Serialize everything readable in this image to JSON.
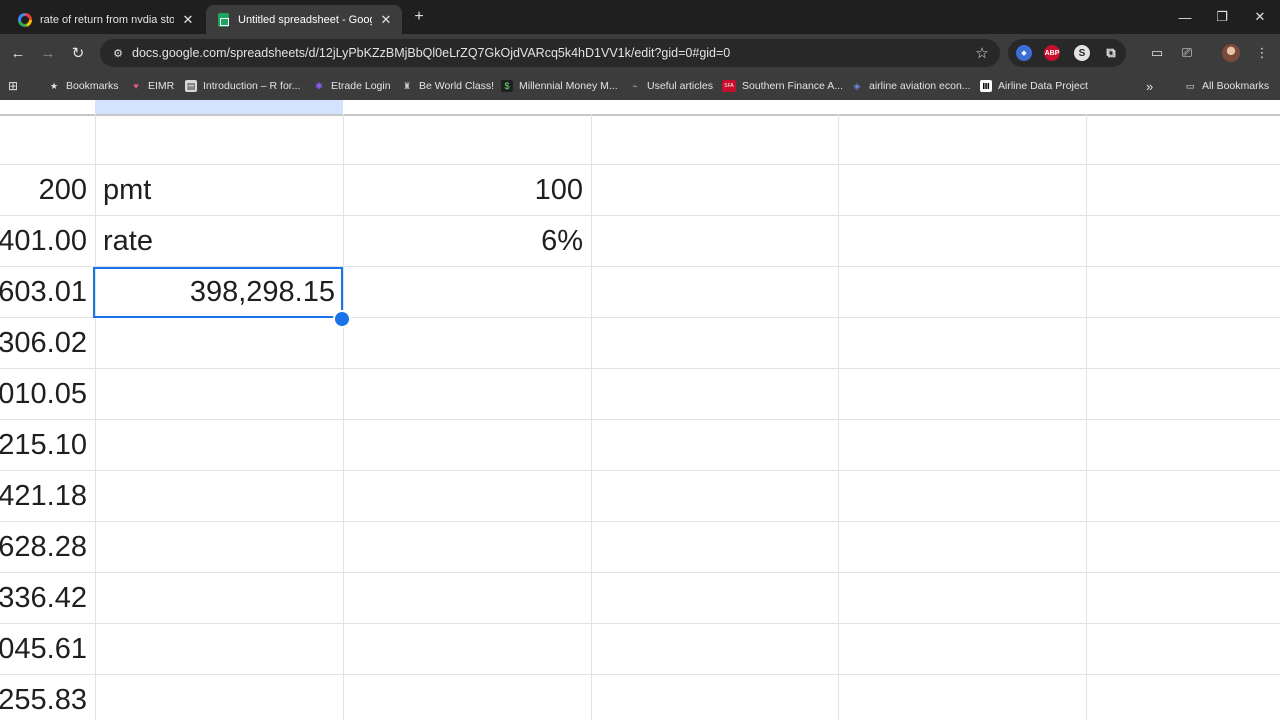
{
  "browser": {
    "tabs": [
      {
        "title": "rate of return from nvdia stock",
        "favicon": "google-icon",
        "active": false
      },
      {
        "title": "Untitled spreadsheet - Google S",
        "favicon": "sheets-icon",
        "active": true
      }
    ],
    "new_tab_label": "+",
    "window_controls": {
      "minimize": "—",
      "restore": "❐",
      "close": "✕"
    },
    "url": "docs.google.com/spreadsheets/d/12jLyPbKZzBMjBbQl0eLrZQ7GkOjdVARcq5k4hD1VV1k/edit?gid=0#gid=0",
    "bookmarks": [
      {
        "label": "Bookmarks",
        "icon": "star-icon"
      },
      {
        "label": "EIMR",
        "icon": "heart-icon"
      },
      {
        "label": "Introduction – R for...",
        "icon": "page-icon"
      },
      {
        "label": "Etrade Login",
        "icon": "etrade-icon"
      },
      {
        "label": "Be World Class!",
        "icon": "trophy-icon"
      },
      {
        "label": "Millennial Money M...",
        "icon": "dollar-icon"
      },
      {
        "label": "Useful articles",
        "icon": "link-icon"
      },
      {
        "label": "Southern Finance A...",
        "icon": "sfa-icon"
      },
      {
        "label": "airline aviation econ...",
        "icon": "plane-icon"
      },
      {
        "label": "Airline Data Project",
        "icon": "mit-icon"
      }
    ],
    "more_bookmarks": "»",
    "all_bookmarks": "All Bookmarks"
  },
  "sheet": {
    "columnA": [
      "200",
      "401.00",
      "603.01",
      "306.02",
      "010.05",
      "215.10",
      "421.18",
      "628.28",
      "336.42",
      "045.61",
      "255.83"
    ],
    "columnB": [
      "pmt",
      "rate",
      "398,298.15"
    ],
    "columnC": [
      "100",
      "6%"
    ],
    "selected_cell_value": "398,298.15"
  }
}
